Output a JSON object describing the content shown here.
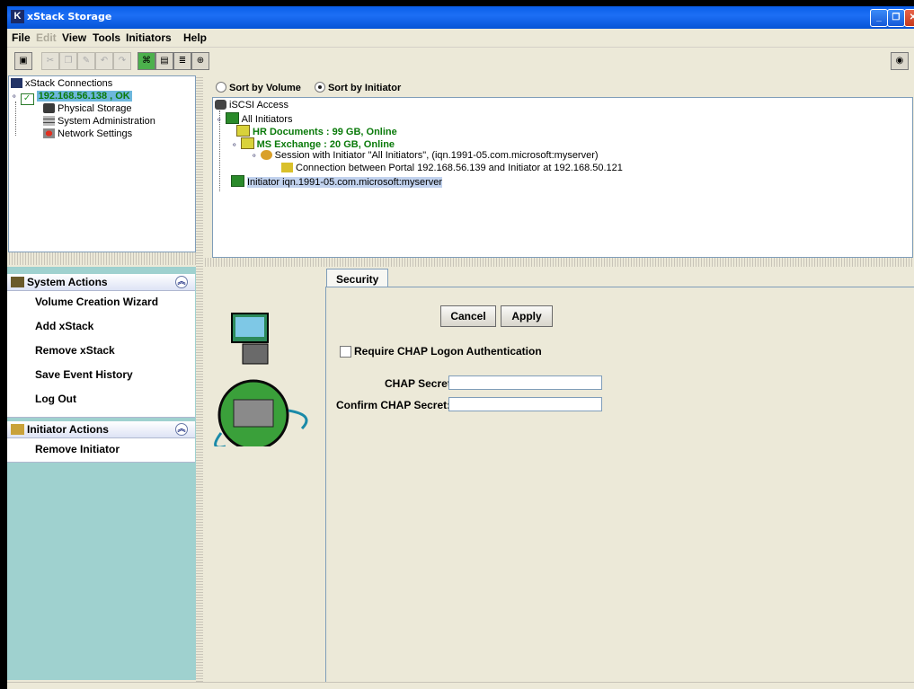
{
  "window": {
    "title": "xStack Storage"
  },
  "menu": [
    {
      "label": "File",
      "enabled": true
    },
    {
      "label": "Edit",
      "enabled": false
    },
    {
      "label": "View",
      "enabled": true
    },
    {
      "label": "Tools",
      "enabled": true
    },
    {
      "label": "Initiators",
      "enabled": true
    },
    {
      "label": "Help",
      "enabled": true
    }
  ],
  "connections": {
    "root": "xStack Connections",
    "node": "192.168.56.138 , OK",
    "children": [
      "Physical Storage",
      "System Administration",
      "Network Settings"
    ]
  },
  "sort": {
    "by_volume": "Sort by Volume",
    "by_initiator": "Sort by Initiator",
    "selected": "by_initiator"
  },
  "iscsi_tree": {
    "root": "iSCSI Access",
    "all_initiators": "All Initiators",
    "hr_documents": "HR Documents : 99 GB, Online",
    "ms_exchange": "MS Exchange : 20 GB, Online",
    "session": "Session with Initiator \"All Initiators\", (iqn.1991-05.com.microsoft:myserver)",
    "connection": "Connection between Portal 192.168.56.139 and Initiator at  192.168.50.121",
    "initiator": "Initiator iqn.1991-05.com.microsoft:myserver"
  },
  "system_actions": {
    "title": "System Actions",
    "items": [
      "Volume Creation Wizard",
      "Add xStack",
      "Remove xStack",
      "Save Event History",
      "Log Out"
    ]
  },
  "initiator_actions": {
    "title": "Initiator Actions",
    "items": [
      "Remove Initiator"
    ]
  },
  "security_tab": {
    "tab_label": "Security",
    "cancel": "Cancel",
    "apply": "Apply",
    "require_chap": "Require CHAP Logon Authentication",
    "require_chap_checked": false,
    "chap_secret_label": "CHAP Secret:",
    "chap_secret_value": "",
    "confirm_chap_label": "Confirm CHAP Secret:",
    "confirm_chap_value": ""
  },
  "colors": {
    "titlebar": "#0a5ee8",
    "online_green": "#0a7a0a",
    "action_panel_bg": "#9fd1cf"
  }
}
